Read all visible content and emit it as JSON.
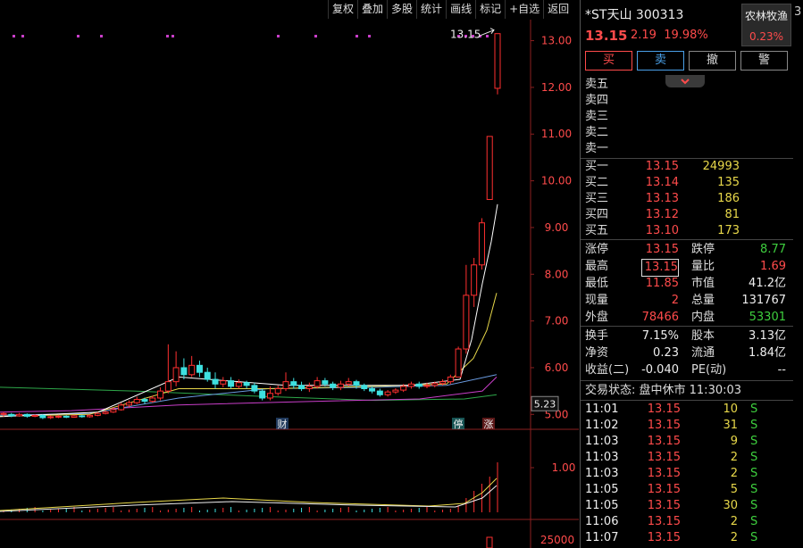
{
  "toolbar": [
    "复权",
    "叠加",
    "多股",
    "统计",
    "画线",
    "标记",
    "+自选",
    "返回"
  ],
  "stock": {
    "name": "*ST天山",
    "code": "300313",
    "price": "13.15",
    "change": "2.19",
    "pct": "19.98%"
  },
  "sector": {
    "name": "农林牧渔",
    "pct": "0.23%"
  },
  "actions": [
    "买",
    "卖",
    "撤",
    "警"
  ],
  "expand_icon": "chevron-down-icon",
  "sell_book": [
    {
      "label": "卖五",
      "price": "",
      "vol": ""
    },
    {
      "label": "卖四",
      "price": "",
      "vol": ""
    },
    {
      "label": "卖三",
      "price": "",
      "vol": ""
    },
    {
      "label": "卖二",
      "price": "",
      "vol": ""
    },
    {
      "label": "卖一",
      "price": "",
      "vol": ""
    }
  ],
  "buy_book": [
    {
      "label": "买一",
      "price": "13.15",
      "vol": "24993"
    },
    {
      "label": "买二",
      "price": "13.14",
      "vol": "135"
    },
    {
      "label": "买三",
      "price": "13.13",
      "vol": "186"
    },
    {
      "label": "买四",
      "price": "13.12",
      "vol": "81"
    },
    {
      "label": "买五",
      "price": "13.10",
      "vol": "173"
    }
  ],
  "stats": [
    {
      "l1": "涨停",
      "v1": "13.15",
      "c1": "red",
      "l2": "跌停",
      "v2": "8.77",
      "c2": "green"
    },
    {
      "l1": "最高",
      "v1": "13.15",
      "c1": "red",
      "l2": "量比",
      "v2": "1.69",
      "c2": "red"
    },
    {
      "l1": "最低",
      "v1": "11.85",
      "c1": "red",
      "l2": "市值",
      "v2": "41.2亿",
      "c2": "white"
    },
    {
      "l1": "现量",
      "v1": "2",
      "c1": "red",
      "l2": "总量",
      "v2": "131767",
      "c2": "white"
    },
    {
      "l1": "外盘",
      "v1": "78466",
      "c1": "red",
      "l2": "内盘",
      "v2": "53301",
      "c2": "green"
    }
  ],
  "stats2": [
    {
      "l1": "换手",
      "v1": "7.15%",
      "l2": "股本",
      "v2": "3.13亿"
    },
    {
      "l1": "净资",
      "v1": "0.23",
      "l2": "流通",
      "v2": "1.84亿"
    },
    {
      "l1": "收益(二)",
      "v1": "-0.040",
      "l2": "PE(动)",
      "v2": "--"
    }
  ],
  "trade_status": "交易状态: 盘中休市 11:30:03",
  "ticks": [
    {
      "t": "11:01",
      "p": "13.15",
      "v": "10",
      "s": "S"
    },
    {
      "t": "11:02",
      "p": "13.15",
      "v": "31",
      "s": "S"
    },
    {
      "t": "11:03",
      "p": "13.15",
      "v": "9",
      "s": "S"
    },
    {
      "t": "11:03",
      "p": "13.15",
      "v": "2",
      "s": "S"
    },
    {
      "t": "11:03",
      "p": "13.15",
      "v": "2",
      "s": "S"
    },
    {
      "t": "11:05",
      "p": "13.15",
      "v": "5",
      "s": "S"
    },
    {
      "t": "11:05",
      "p": "13.15",
      "v": "30",
      "s": "S"
    },
    {
      "t": "11:06",
      "p": "13.15",
      "v": "2",
      "s": "S"
    },
    {
      "t": "11:07",
      "p": "13.15",
      "v": "2",
      "s": "S"
    }
  ],
  "chart_data": {
    "type": "candlestick",
    "price_axis": [
      "13.00",
      "12.00",
      "11.00",
      "10.00",
      "9.00",
      "8.00",
      "7.00",
      "6.00",
      "5.00"
    ],
    "price_range": [
      4.7,
      13.45
    ],
    "high_label": "13.15",
    "current_level": "5.23",
    "markers": [
      "财",
      "停",
      "涨"
    ],
    "volume_axis": [
      "1.00"
    ],
    "volume_axis_bottom": "25000",
    "candles": [
      [
        5.0,
        5.02,
        4.95,
        5.05
      ],
      [
        5.0,
        4.97,
        4.94,
        5.03
      ],
      [
        4.97,
        5.0,
        4.95,
        5.03
      ],
      [
        5.0,
        4.96,
        4.93,
        5.02
      ],
      [
        4.96,
        4.98,
        4.94,
        5.0
      ],
      [
        4.98,
        4.93,
        4.9,
        5.0
      ],
      [
        4.93,
        4.95,
        4.9,
        4.98
      ],
      [
        4.95,
        4.96,
        4.92,
        4.99
      ],
      [
        4.96,
        4.94,
        4.92,
        4.98
      ],
      [
        4.94,
        4.97,
        4.93,
        4.99
      ],
      [
        4.97,
        4.95,
        4.93,
        4.99
      ],
      [
        4.95,
        4.98,
        4.93,
        5.0
      ],
      [
        4.98,
        5.02,
        4.96,
        5.05
      ],
      [
        5.02,
        5.05,
        5.0,
        5.08
      ],
      [
        5.05,
        5.1,
        5.03,
        5.15
      ],
      [
        5.1,
        5.2,
        5.08,
        5.25
      ],
      [
        5.2,
        5.25,
        5.15,
        5.3
      ],
      [
        5.25,
        5.32,
        5.22,
        5.38
      ],
      [
        5.32,
        5.28,
        5.22,
        5.36
      ],
      [
        5.28,
        5.35,
        5.25,
        5.4
      ],
      [
        5.35,
        5.5,
        5.3,
        5.58
      ],
      [
        5.5,
        5.7,
        5.45,
        6.5
      ],
      [
        5.7,
        6.0,
        5.6,
        6.35
      ],
      [
        6.0,
        5.85,
        5.75,
        6.2
      ],
      [
        5.85,
        6.05,
        5.8,
        6.25
      ],
      [
        6.05,
        5.9,
        5.8,
        6.15
      ],
      [
        5.9,
        5.75,
        5.7,
        6.0
      ],
      [
        5.75,
        5.65,
        5.55,
        5.9
      ],
      [
        5.65,
        5.72,
        5.58,
        5.8
      ],
      [
        5.72,
        5.6,
        5.55,
        5.8
      ],
      [
        5.6,
        5.68,
        5.55,
        5.75
      ],
      [
        5.68,
        5.62,
        5.55,
        5.72
      ],
      [
        5.62,
        5.5,
        5.45,
        5.68
      ],
      [
        5.5,
        5.35,
        5.3,
        5.55
      ],
      [
        5.35,
        5.45,
        5.3,
        5.6
      ],
      [
        5.45,
        5.55,
        5.4,
        5.62
      ],
      [
        5.55,
        5.7,
        5.5,
        5.9
      ],
      [
        5.7,
        5.62,
        5.55,
        5.78
      ],
      [
        5.62,
        5.55,
        5.5,
        5.7
      ],
      [
        5.55,
        5.6,
        5.48,
        5.68
      ],
      [
        5.6,
        5.72,
        5.55,
        5.8
      ],
      [
        5.72,
        5.65,
        5.6,
        5.78
      ],
      [
        5.65,
        5.58,
        5.52,
        5.7
      ],
      [
        5.58,
        5.65,
        5.52,
        5.72
      ],
      [
        5.65,
        5.7,
        5.6,
        5.78
      ],
      [
        5.7,
        5.62,
        5.55,
        5.74
      ],
      [
        5.62,
        5.55,
        5.5,
        5.66
      ],
      [
        5.55,
        5.5,
        5.45,
        5.6
      ],
      [
        5.5,
        5.42,
        5.38,
        5.55
      ],
      [
        5.42,
        5.48,
        5.38,
        5.52
      ],
      [
        5.48,
        5.52,
        5.44,
        5.56
      ],
      [
        5.52,
        5.6,
        5.48,
        5.65
      ],
      [
        5.6,
        5.65,
        5.55,
        5.7
      ],
      [
        5.65,
        5.6,
        5.55,
        5.7
      ],
      [
        5.6,
        5.62,
        5.56,
        5.68
      ],
      [
        5.62,
        5.66,
        5.58,
        5.7
      ],
      [
        5.66,
        5.7,
        5.62,
        5.75
      ],
      [
        5.7,
        5.8,
        5.65,
        5.85
      ],
      [
        5.8,
        6.4,
        5.8,
        6.45
      ],
      [
        6.4,
        7.55,
        6.3,
        8.2
      ],
      [
        7.55,
        8.2,
        7.3,
        8.35
      ],
      [
        8.2,
        9.1,
        8.1,
        9.2
      ],
      [
        9.6,
        10.95,
        9.6,
        10.95
      ],
      [
        11.98,
        13.15,
        11.85,
        13.15
      ]
    ]
  }
}
